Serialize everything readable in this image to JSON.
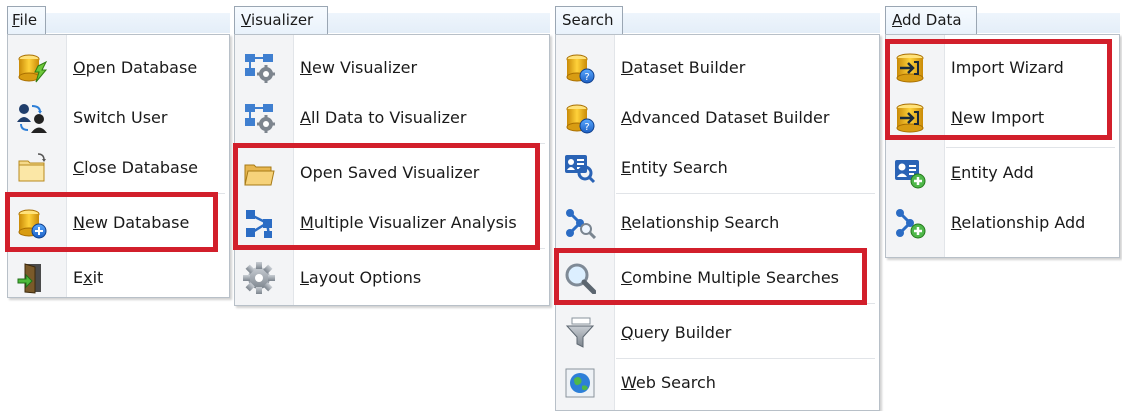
{
  "menus": {
    "file": {
      "title": "File",
      "items": [
        {
          "label": "Open Database",
          "icon": "open-database-icon"
        },
        {
          "label": "Switch User",
          "icon": "switch-user-icon"
        },
        {
          "label": "Close Database",
          "icon": "close-database-icon"
        },
        {
          "label": "New Database",
          "icon": "new-database-icon"
        },
        {
          "label": "Exit",
          "icon": "exit-icon"
        }
      ]
    },
    "visualizer": {
      "title": "Visualizer",
      "items": [
        {
          "label": "New Visualizer",
          "icon": "new-visualizer-icon"
        },
        {
          "label": "All Data to Visualizer",
          "icon": "all-data-to-visualizer-icon"
        },
        {
          "label": "Open Saved Visualizer",
          "icon": "folder-icon"
        },
        {
          "label": "Multiple Visualizer Analysis",
          "icon": "network-icon"
        },
        {
          "label": "Layout Options",
          "icon": "gear-icon"
        }
      ]
    },
    "search": {
      "title": "Search",
      "items": [
        {
          "label": "Dataset Builder",
          "icon": "dataset-builder-icon"
        },
        {
          "label": "Advanced Dataset Builder",
          "icon": "advanced-dataset-builder-icon"
        },
        {
          "label": "Entity Search",
          "icon": "entity-search-icon"
        },
        {
          "label": "Relationship Search",
          "icon": "relationship-search-icon"
        },
        {
          "label": "Combine Multiple Searches",
          "icon": "magnifier-icon"
        },
        {
          "label": "Query Builder",
          "icon": "funnel-icon"
        },
        {
          "label": "Web Search",
          "icon": "globe-icon"
        }
      ]
    },
    "add_data": {
      "title": "Add Data",
      "items": [
        {
          "label": "Import Wizard",
          "icon": "import-wizard-icon"
        },
        {
          "label": "New Import",
          "icon": "new-import-icon"
        },
        {
          "label": "Entity Add",
          "icon": "entity-add-icon"
        },
        {
          "label": "Relationship Add",
          "icon": "relationship-add-icon"
        }
      ]
    }
  },
  "colors": {
    "highlight_border": "#d21f2b",
    "menu_header_bg": "#e9f2fb",
    "gutter_bg": "#f3f4f6"
  }
}
